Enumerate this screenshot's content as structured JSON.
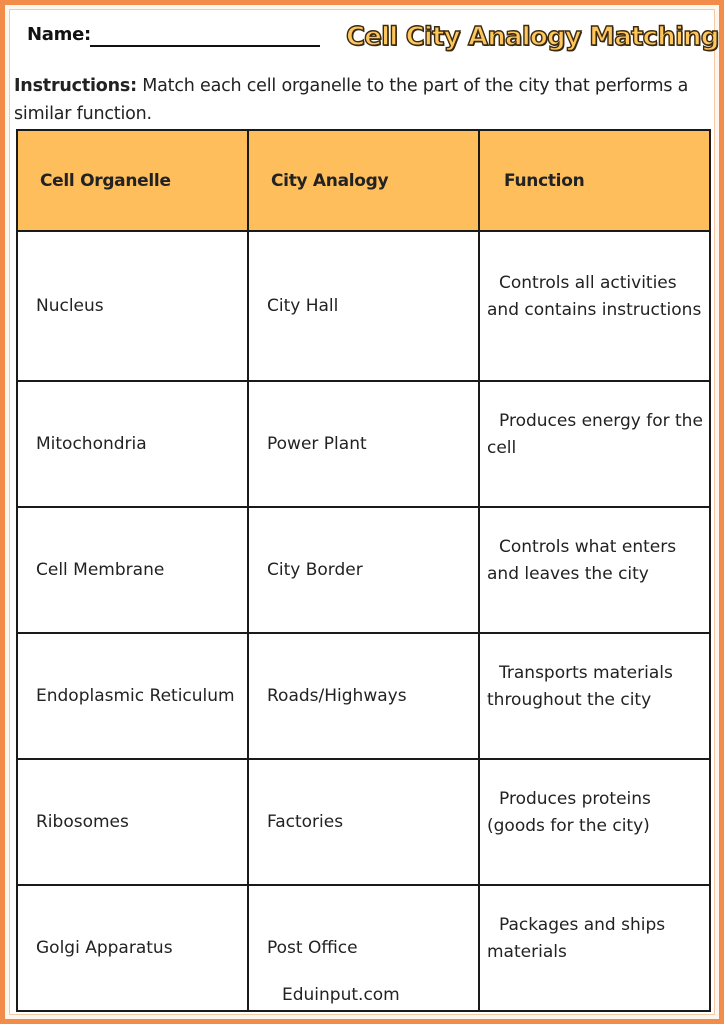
{
  "header": {
    "name_label": "Name:",
    "title": "Cell City Analogy Matching"
  },
  "instructions": {
    "label": "Instructions:",
    "text": " Match each cell organelle to the part of the city that performs a similar function."
  },
  "table": {
    "headers": [
      "Cell Organelle",
      "City Analogy",
      "Function"
    ],
    "rows": [
      {
        "organelle": "Nucleus",
        "analogy": "City Hall",
        "function": "Controls all activities and contains instructions"
      },
      {
        "organelle": "Mitochondria",
        "analogy": "Power Plant",
        "function": "Produces energy for the cell"
      },
      {
        "organelle": "Cell Membrane",
        "analogy": "City Border",
        "function": "Controls what enters and leaves the city"
      },
      {
        "organelle": "Endoplasmic Reticulum",
        "analogy": "Roads/Highways",
        "function": "Transports materials throughout the city"
      },
      {
        "organelle": "Ribosomes",
        "analogy": "Factories",
        "function": "Produces proteins (goods for the city)"
      },
      {
        "organelle": "Golgi Apparatus",
        "analogy": "Post Office",
        "function": "Packages and ships materials"
      }
    ]
  },
  "footer": {
    "watermark": "Eduinput.com"
  },
  "colors": {
    "border": "#f28c4a",
    "header_fill": "#ffbe5c",
    "title_fill": "#ffc65e"
  }
}
